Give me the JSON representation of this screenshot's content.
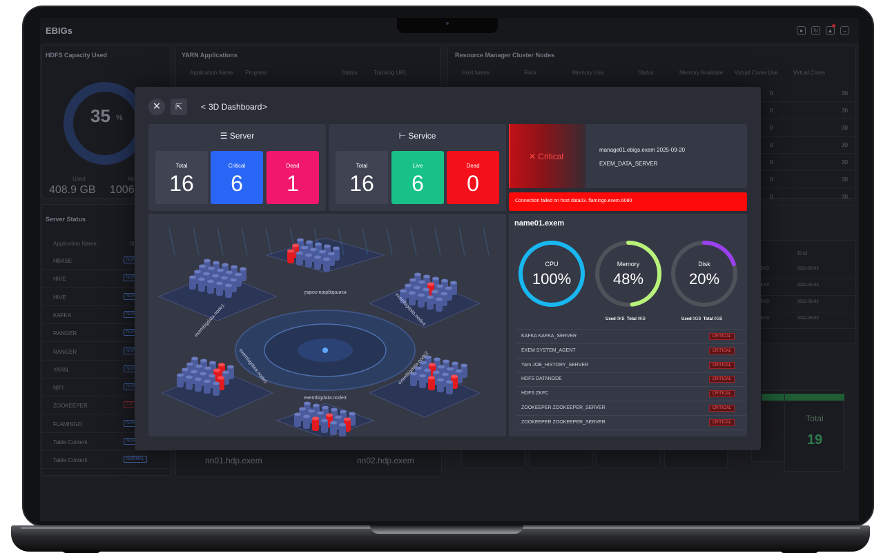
{
  "app": {
    "title": "EBIGs"
  },
  "background": {
    "hdfs": {
      "title": "HDFS Capacity Used",
      "percent": "35",
      "unit": "%",
      "used_label": "Used",
      "used": "408.9 GB",
      "max_label": "Ma",
      "max": "1006."
    },
    "yarn": {
      "title": "YARN Applications",
      "col_name": "Application Name",
      "col_progress": "Progress",
      "col_status": "Status",
      "col_url": "Tracking URL"
    },
    "rm": {
      "title": "Resource Manager Cluster Nodes",
      "columns": [
        "Host Name",
        "Rack",
        "Memory Use",
        "Status",
        "Memory Available",
        "Virtual Cores Use",
        "Virtual Cores"
      ],
      "rows": [
        {
          "cores_use": "0",
          "cores": "30"
        },
        {
          "cores_use": "0",
          "cores": "30"
        },
        {
          "cores_use": "0",
          "cores": "30"
        },
        {
          "cores_use": "0",
          "cores": "30"
        },
        {
          "cores_use": "0",
          "cores": "30"
        },
        {
          "cores_use": "0",
          "cores": "30"
        },
        {
          "cores_use": "0",
          "cores": "30"
        }
      ]
    },
    "server_status": {
      "title": "Server Status",
      "col_name": "Application Name",
      "col_status": "St",
      "items": [
        {
          "name": "HBASE",
          "status": "NOR"
        },
        {
          "name": "HIVE",
          "status": "NOR"
        },
        {
          "name": "HIVE",
          "status": "NOR"
        },
        {
          "name": "KAFKA",
          "status": "NOR"
        },
        {
          "name": "RANGER",
          "status": "NOR"
        },
        {
          "name": "RANGER",
          "status": "NOR"
        },
        {
          "name": "YARN",
          "status": "NOR"
        },
        {
          "name": "NIFI",
          "status": "NOR"
        },
        {
          "name": "ZOOKEEPER",
          "status": "CRIT"
        },
        {
          "name": "FLAMINGO",
          "status": "NOR"
        },
        {
          "name": "Table Content",
          "status": "NOR"
        },
        {
          "name": "Table Content",
          "status": "NORMAL"
        }
      ]
    },
    "hosts": {
      "nn01": "nn01.hdp.exem",
      "nn02": "nn02.hdp.exem"
    },
    "history": {
      "col_end": "End",
      "rows": [
        {
          "a": "2-05-03",
          "b": "2022-05-03"
        },
        {
          "a": "2-05-03",
          "b": "2022-05-03"
        },
        {
          "a": "2-05-03",
          "b": "2022-05-03"
        },
        {
          "a": "2-05-03",
          "b": "2022-05-03"
        }
      ]
    },
    "total": {
      "label": "Total",
      "value": "19"
    }
  },
  "modal": {
    "title": "3D Dashboard",
    "prev": "<",
    "next": ">",
    "close_icon": "close-icon",
    "expand_icon": "expand-icon",
    "server": {
      "title": "Server",
      "total_label": "Total",
      "total": "16",
      "critical_label": "Critical",
      "critical": "6",
      "dead_label": "Dead",
      "dead": "1"
    },
    "service": {
      "title": "Service",
      "total_label": "Total",
      "total": "16",
      "live_label": "Live",
      "live": "6",
      "dead_label": "Dead",
      "dead": "0"
    },
    "alert": {
      "level": "Critical",
      "host_date": "manage01.ebigs.exem 2025-09-20",
      "service": "EXEM_DATA_SERVER",
      "message": "Connection failed on host data03. flamingo.exem.6080"
    },
    "nodes": {
      "node1": "exembigdata.node1",
      "node2": "exembigdata.node2",
      "node3": "exembigdata.node3",
      "node4": "exembigdata.node4",
      "node5": "exembigdata.node5"
    },
    "detail": {
      "host": "name01.exem",
      "cpu": {
        "label": "CPU",
        "value": "100%",
        "fraction": 1.0
      },
      "memory": {
        "label": "Memory",
        "value": "48%",
        "fraction": 0.48,
        "used_label": "Used",
        "used": "0KB",
        "total_label": "Total",
        "total": "0KB"
      },
      "disk": {
        "label": "Disk",
        "value": "20%",
        "fraction": 0.2,
        "used_label": "Used",
        "used": "0GB",
        "total_label": "Total",
        "total": "0GB"
      },
      "services": [
        {
          "name": "KAFKA KAFKA_SERVER",
          "status": "CRITICAL"
        },
        {
          "name": "EXEM SYSTEM_AGENT",
          "status": "CRITICAL"
        },
        {
          "name": "Yarn JOB_HISTORY_SERVER",
          "status": "CRITICAL"
        },
        {
          "name": "HDFS DATANODE",
          "status": "CRITICAL"
        },
        {
          "name": "HDFS ZKFC",
          "status": "CRITICAL"
        },
        {
          "name": "ZOOKEEPER ZOOKEEPER_SERVER",
          "status": "CRITICAL"
        },
        {
          "name": "ZOOKEEPER ZOOKEEPER_SERVER",
          "status": "CRITICAL"
        }
      ]
    }
  },
  "colors": {
    "critical_blue": "#2a66f5",
    "dead_pink": "#f0176c",
    "live_green": "#17c188",
    "dead_red": "#f4101a",
    "cpu_ring": "#18b7f0",
    "memory_ring": "#b8f27a",
    "disk_ring": "#9a40ee"
  }
}
